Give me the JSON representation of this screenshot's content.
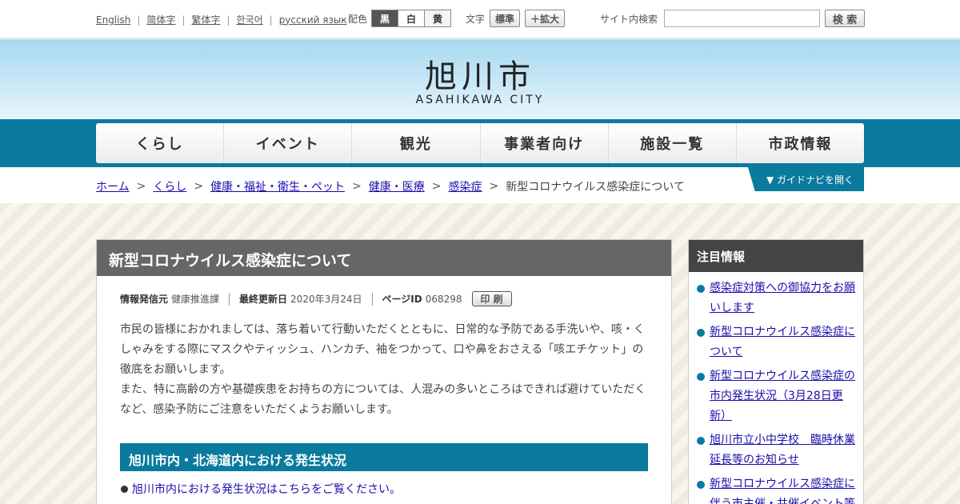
{
  "utility": {
    "languages": [
      "English",
      "简体字",
      "繁体字",
      "한국어",
      "русский язык"
    ],
    "color_label": "配色",
    "color_buttons": [
      "黒",
      "白",
      "黄"
    ],
    "text_label": "文字",
    "text_buttons": [
      "標準",
      "＋拡大"
    ],
    "search_label": "サイト内検索",
    "search_value": "",
    "search_button": "検 索"
  },
  "header": {
    "logo_jp": "旭川市",
    "logo_en": "ASAHIKAWA CITY"
  },
  "nav": [
    "くらし",
    "イベント",
    "観光",
    "事業者向け",
    "施設一覧",
    "市政情報"
  ],
  "breadcrumb": {
    "links": [
      "ホーム",
      "くらし",
      "健康・福祉・衛生・ペット",
      "健康・医療",
      "感染症"
    ],
    "current": "新型コロナウイルス感染症について",
    "separator": ">"
  },
  "guide_button": "▼ ガイドナビを開く",
  "article": {
    "title": "新型コロナウイルス感染症について",
    "meta": {
      "source_label": "情報発信元",
      "source_value": "健康推進課",
      "updated_label": "最終更新日",
      "updated_value": "2020年3月24日",
      "pageid_label": "ページID",
      "pageid_value": "068298",
      "print_button": "印 刷"
    },
    "paragraph1": "市民の皆様におかれましては、落ち着いて行動いただくとともに、日常的な予防である手洗いや、咳・くしゃみをする際にマスクやティッシュ、ハンカチ、袖をつかって、口や鼻をおさえる「咳エチケット」の徹底をお願いします。",
    "paragraph2": "また、特に高齢の方や基礎疾患をお持ちの方については、人混みの多いところはできれば避けていただくなど、感染予防にご注意をいただくようお願いします。",
    "section_heading": "旭川市内・北海道内における発生状況",
    "section_link": "旭川市内における発生状況はこちらをご覧ください。"
  },
  "sidebar": {
    "heading": "注目情報",
    "items": [
      "感染症対策への御協力をお願いします",
      "新型コロナウイルス感染症について",
      "新型コロナウイルス感染症の市内発生状況（3月28日更新）",
      "旭川市立小中学校　臨時休業延長等のお知らせ",
      "新型コロナウイルス感染症に伴う市主催・共催イベント等"
    ]
  }
}
